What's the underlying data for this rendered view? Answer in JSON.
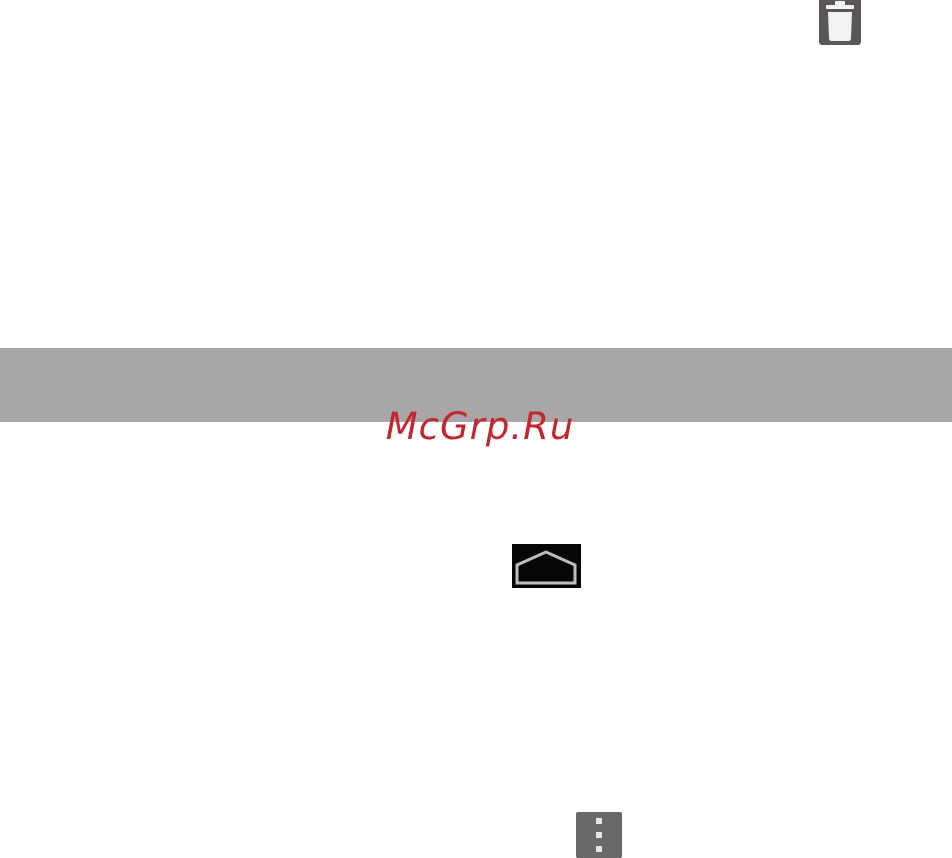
{
  "icons": {
    "trash": "trash-can-icon",
    "home": "home-icon",
    "menu": "overflow-menu-icon"
  },
  "watermark": {
    "text": "McGrp.Ru"
  },
  "colors": {
    "band": "#a8a6a7",
    "watermark": "#c4262e",
    "icon_dark": "#060606",
    "icon_gray": "#5b5758"
  }
}
